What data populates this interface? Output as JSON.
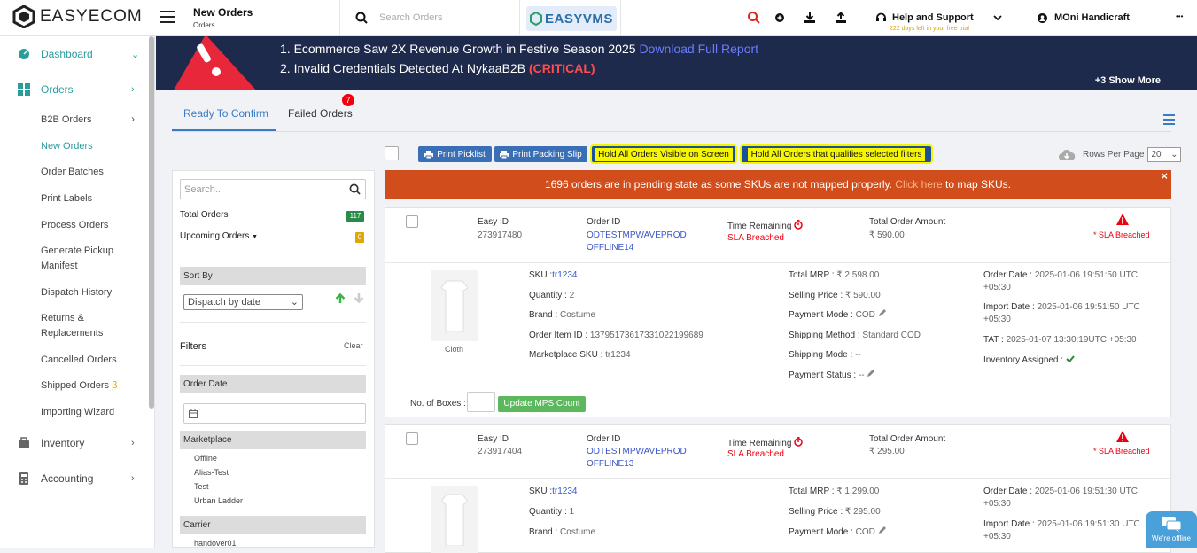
{
  "header": {
    "brand": "EASYECOM",
    "page_title": "New Orders",
    "page_subtitle": "Orders",
    "search_placeholder": "Search Orders",
    "vms_brand": "EASYVMS",
    "help_label": "Help and Support",
    "trial_text": "222 days left in your free trial",
    "user_name": "MOni Handicraft",
    "more": "•••"
  },
  "sidebar": {
    "dashboard": "Dashboard",
    "orders": "Orders",
    "sub_items": [
      "B2B Orders",
      "New Orders",
      "Order Batches",
      "Print Labels",
      "Process Orders",
      "Generate Pickup Manifest",
      "Dispatch History",
      "Returns & Replacements",
      "Cancelled Orders",
      "Shipped Orders",
      "Importing Wizard"
    ],
    "beta": "β",
    "inventory": "Inventory",
    "accounting": "Accounting",
    "colors": {
      "active": "#2a9d9a"
    }
  },
  "banner": {
    "line1": "1. Ecommerce Saw 2X Revenue Growth in Festive Season 2025 ",
    "line1_link": "Download Full Report",
    "line2": "2. Invalid Credentials Detected At NykaaB2B ",
    "line2_tag": "(CRITICAL)",
    "show_more": "+3 Show More"
  },
  "tabs": {
    "ready": "Ready To Confirm",
    "failed": "Failed Orders",
    "failed_count": "7"
  },
  "toolbar": {
    "print_picklist": "Print Picklist",
    "print_packing_slip": "Print Packing Slip",
    "hold_visible": "Hold All Orders Visible on Screen",
    "hold_filtered": "Hold All Orders that qualifies selected filters",
    "rows_per_page_label": "Rows Per Page",
    "rows_per_page_value": "20"
  },
  "filters": {
    "search_placeholder": "Search...",
    "total_orders_label": "Total Orders",
    "total_orders_count": "117",
    "upcoming_orders_label": "Upcoming Orders",
    "upcoming_orders_count": "0",
    "sort_by": "Sort By",
    "sort_value": "Dispatch by date",
    "filters_label": "Filters",
    "clear": "Clear",
    "order_date": "Order Date",
    "marketplace": "Marketplace",
    "marketplace_items": [
      "Offline",
      "Alias-Test",
      "Test",
      "Urban Ladder"
    ],
    "carrier": "Carrier",
    "carrier_items": [
      "handover01"
    ]
  },
  "notice": {
    "text": "1696 orders are in pending state as some SKUs are not mapped properly. ",
    "link": "Click here",
    "tail": " to map SKUs.",
    "close": "×"
  },
  "labels": {
    "easy_id": "Easy ID",
    "order_id": "Order ID",
    "time_remaining": "Time Remaining",
    "total_order_amount": "Total Order Amount",
    "sku": "SKU :",
    "quantity": "Quantity :",
    "brand": "Brand :",
    "order_item_id": "Order Item ID :",
    "marketplace_sku": "Marketplace SKU :",
    "total_mrp": "Total MRP :",
    "selling_price": "Selling Price :",
    "payment_mode": "Payment Mode :",
    "shipping_method": "Shipping Method :",
    "shipping_mode": "Shipping Mode :",
    "payment_status": "Payment Status :",
    "order_date": "Order Date :",
    "import_date": "Import Date :",
    "tat": "TAT :",
    "inventory_assigned": "Inventory Assigned :",
    "no_of_boxes": "No. of Boxes :",
    "update_mps": "Update MPS Count"
  },
  "orders": [
    {
      "easy_id": "273917480",
      "order_id_1": "ODTESTMPWAVEPROD",
      "order_id_2": "OFFLINE14",
      "time_status": "SLA Breached",
      "amount": "₹ 590.00",
      "sla_flag": "* SLA Breached",
      "sku": "tr1234",
      "quantity": "2",
      "brand": "Costume",
      "order_item_id": "1379517361733102219968​9",
      "marketplace_sku": "tr1234",
      "total_mrp": "₹ 2,598.00",
      "selling_price": "₹ 590.00",
      "payment_mode": "COD",
      "shipping_method": "Standard COD",
      "shipping_mode": "--",
      "payment_status": "--",
      "order_date_1": "2025-01-06 19:51:50 UTC",
      "order_date_2": "+05:30",
      "import_date_1": "2025-01-06 19:51:50 UTC",
      "import_date_2": "+05:30",
      "tat": "2025-01-07 13:30:19UTC +05:30",
      "product_caption": "Cloth"
    },
    {
      "easy_id": "273917404",
      "order_id_1": "ODTESTMPWAVEPROD",
      "order_id_2": "OFFLINE13",
      "time_status": "SLA Breached",
      "amount": "₹ 295.00",
      "sla_flag": "* SLA Breached",
      "sku": "tr1234",
      "quantity": "1",
      "brand": "Costume",
      "total_mrp": "₹ 1,299.00",
      "selling_price": "₹ 295.00",
      "payment_mode": "COD",
      "order_date_1": "2025-01-06 19:51:30 UTC",
      "order_date_2": "+05:30",
      "import_date_1": "2025-01-06 19:51:30 UTC",
      "import_date_2": "+05:30"
    }
  ],
  "chat": {
    "status": "We're offline"
  }
}
